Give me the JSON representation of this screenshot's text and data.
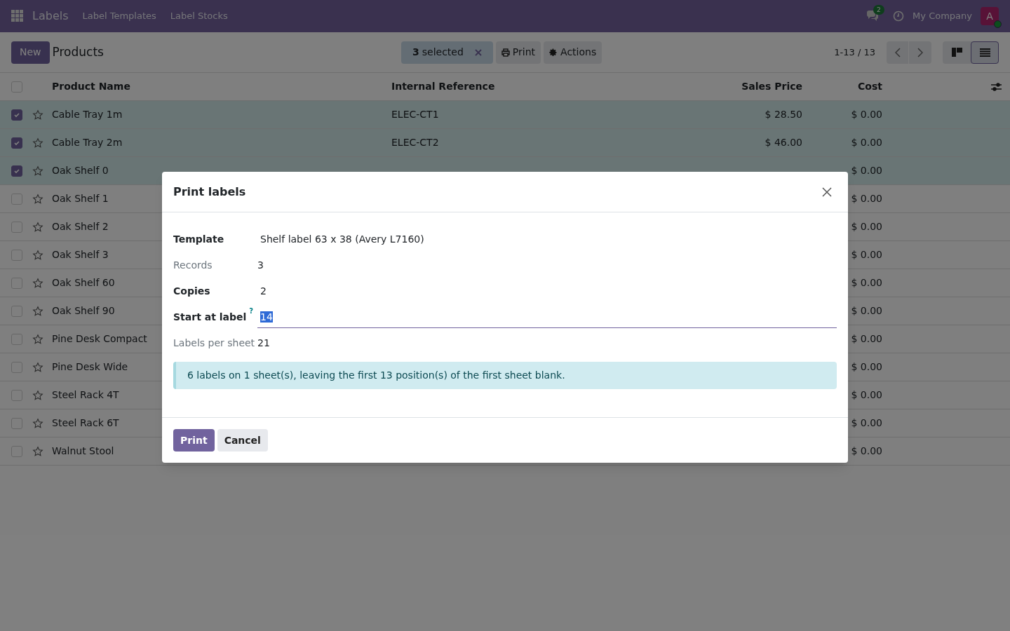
{
  "navbar": {
    "app": "Labels",
    "menu": [
      "Label Templates",
      "Label Stocks"
    ],
    "messages_count": "2",
    "company": "My Company",
    "avatar": "A"
  },
  "control_panel": {
    "new_button": "New",
    "title": "Products",
    "selection": {
      "count": "3",
      "label": "selected"
    },
    "actions": [
      {
        "kind": "print",
        "label": "Print"
      },
      {
        "kind": "gear",
        "label": "Actions"
      }
    ],
    "pager": "1-13 / 13",
    "views": [
      {
        "kind": "kanban",
        "selected": false
      },
      {
        "kind": "list",
        "selected": true
      }
    ]
  },
  "table": {
    "select_all": {
      "checked": false
    },
    "columns": [
      "Product Name",
      "Internal Reference",
      "Sales Price",
      "Cost"
    ],
    "rows": [
      {
        "name": "Cable Tray 1m",
        "ref": "ELEC-CT1",
        "price": "$ 28.50",
        "cost": "$ 0.00",
        "selected": true
      },
      {
        "name": "Cable Tray 2m",
        "ref": "ELEC-CT2",
        "price": "$ 46.00",
        "cost": "$ 0.00",
        "selected": true
      },
      {
        "name": "Oak Shelf 0",
        "cost": "$ 0.00",
        "selected": true
      },
      {
        "name": "Oak Shelf 1",
        "cost": "$ 0.00",
        "selected": false
      },
      {
        "name": "Oak Shelf 2",
        "cost": "$ 0.00",
        "selected": false
      },
      {
        "name": "Oak Shelf 3",
        "cost": "$ 0.00",
        "selected": false
      },
      {
        "name": "Oak Shelf 60",
        "cost": "$ 0.00",
        "selected": false
      },
      {
        "name": "Oak Shelf 90",
        "cost": "$ 0.00",
        "selected": false
      },
      {
        "name": "Pine Desk Compact",
        "cost": "$ 0.00",
        "selected": false
      },
      {
        "name": "Pine Desk Wide",
        "cost": "$ 0.00",
        "selected": false
      },
      {
        "name": "Steel Rack 4T",
        "cost": "$ 0.00",
        "selected": false
      },
      {
        "name": "Steel Rack 6T",
        "cost": "$ 0.00",
        "selected": false
      },
      {
        "name": "Walnut Stool",
        "cost": "$ 0.00",
        "selected": false
      }
    ]
  },
  "dialog": {
    "title": "Print labels",
    "fields": [
      {
        "label": "Template",
        "value": "Shelf label 63 x 38 (Avery L7160)",
        "kind": "text",
        "readonly": false
      },
      {
        "label": "Records",
        "value": "3",
        "kind": "text",
        "readonly": true
      },
      {
        "label": "Copies",
        "value": "2",
        "kind": "text",
        "readonly": false
      },
      {
        "label": "Start at label",
        "help": "?",
        "value": "14",
        "kind": "input",
        "readonly": false
      },
      {
        "label": "Labels per sheet",
        "value": "21",
        "kind": "text",
        "readonly": true
      }
    ],
    "info": "6 labels on 1 sheet(s), leaving the first 13 position(s) of the first sheet blank.",
    "buttons": [
      {
        "label": "Print",
        "primary": true
      },
      {
        "label": "Cancel",
        "primary": false
      }
    ]
  }
}
